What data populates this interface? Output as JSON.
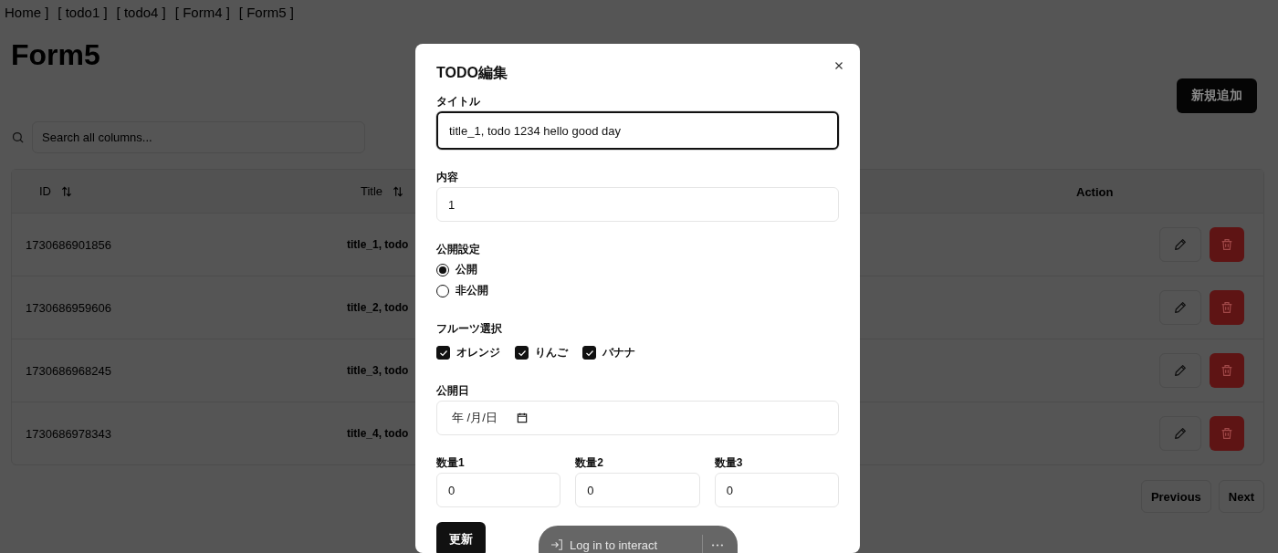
{
  "nav": [
    {
      "label": "Home ]"
    },
    {
      "label": "[ todo1 ]"
    },
    {
      "label": "[ todo4 ]"
    },
    {
      "label": "[ Form4 ]"
    },
    {
      "label": "[ Form5 ]"
    }
  ],
  "page_title": "Form5",
  "add_button": "新規追加",
  "search": {
    "placeholder": "Search all columns..."
  },
  "table": {
    "columns": [
      {
        "label": "ID",
        "sortable": true
      },
      {
        "label": "Title",
        "sortable": true
      },
      {
        "label": "Action",
        "sortable": false
      }
    ],
    "rows": [
      {
        "id": "1730686901856",
        "title": "title_1, todo"
      },
      {
        "id": "1730686959606",
        "title": "title_2, todo"
      },
      {
        "id": "1730686968245",
        "title": "title_3, todo"
      },
      {
        "id": "1730686978343",
        "title": "title_4, todo"
      }
    ]
  },
  "pagination": [
    {
      "label": "Previous"
    },
    {
      "label": "Next"
    }
  ],
  "dialog": {
    "title": "TODO編集",
    "fields": [
      {
        "kind": "text",
        "label": "タイトル",
        "value": "title_1, todo 1234 hello good day",
        "focused": true
      },
      {
        "kind": "text",
        "label": "内容",
        "value": "1",
        "focused": false
      },
      {
        "kind": "radio",
        "label": "公開設定",
        "options": [
          {
            "label": "公開",
            "selected": true
          },
          {
            "label": "非公開",
            "selected": false
          }
        ]
      },
      {
        "kind": "checkbox",
        "label": "フルーツ選択",
        "options": [
          {
            "label": "オレンジ",
            "checked": true
          },
          {
            "label": "りんご",
            "checked": true
          },
          {
            "label": "バナナ",
            "checked": true
          }
        ]
      },
      {
        "kind": "date",
        "label": "公開日",
        "value": "年 /月/日"
      },
      {
        "kind": "numbers",
        "items": [
          {
            "label": "数量1",
            "value": "0"
          },
          {
            "label": "数量2",
            "value": "0"
          },
          {
            "label": "数量3",
            "value": "0"
          }
        ]
      }
    ],
    "submit": "更新"
  },
  "login_bar": {
    "label": "Log in to interact"
  }
}
